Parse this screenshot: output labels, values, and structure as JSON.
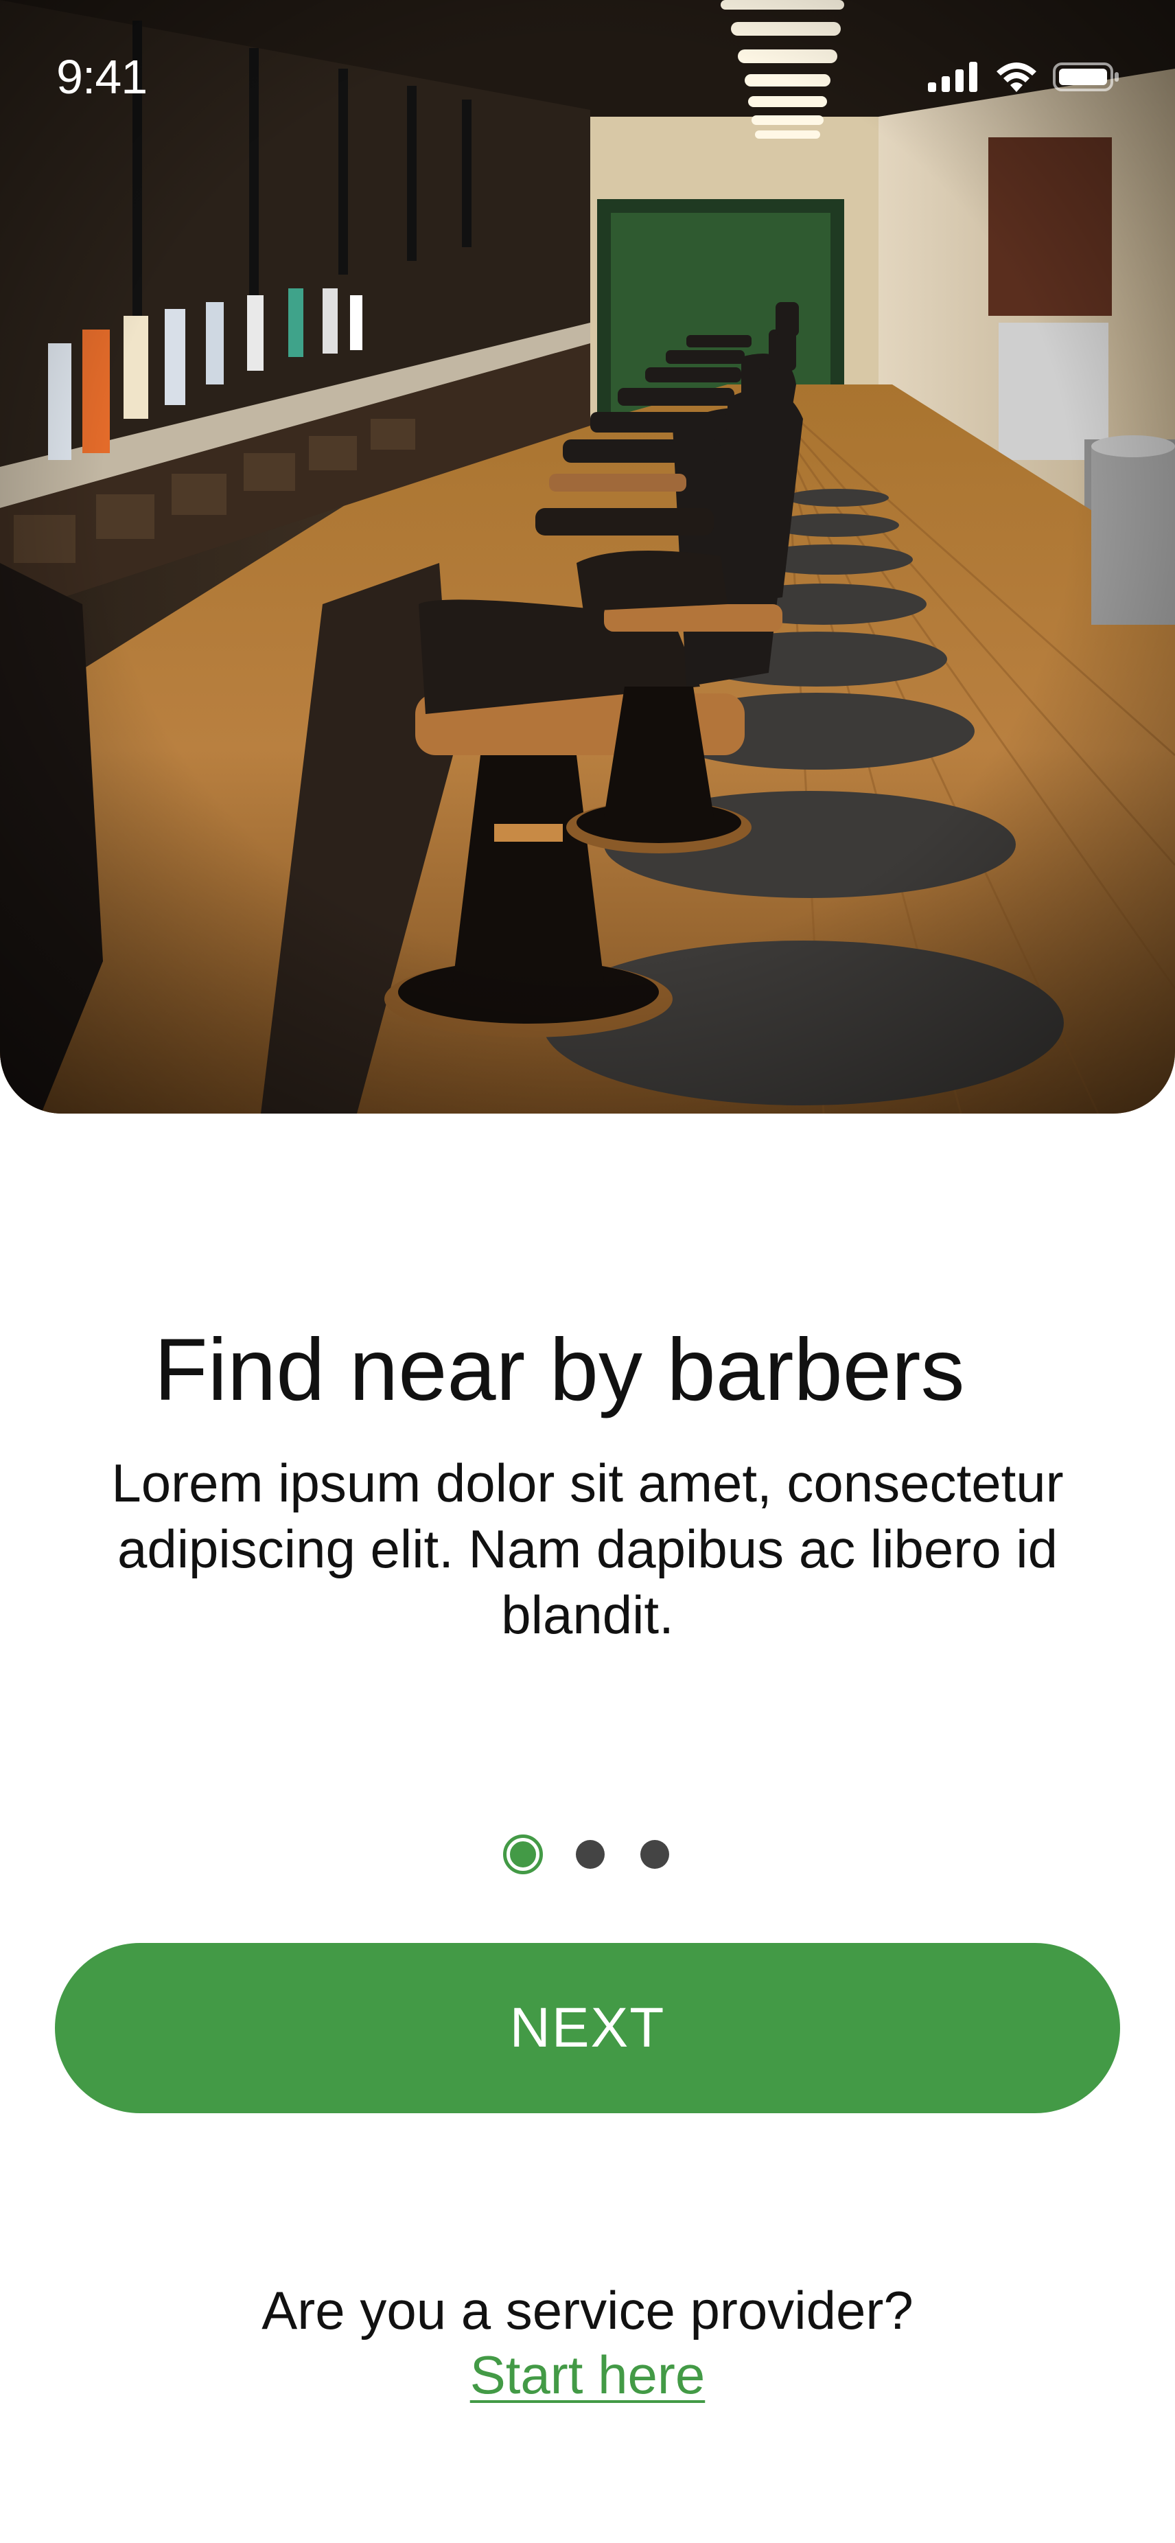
{
  "status_bar": {
    "time": "9:41",
    "icons": [
      "cellular-signal-icon",
      "wifi-icon",
      "battery-icon"
    ]
  },
  "onboarding": {
    "title": "Find near by barbers",
    "description": "Lorem ipsum dolor sit amet, consectetur adipiscing elit. Nam dapibus ac libero id blandit.",
    "page_indicator": {
      "current_page": 1,
      "total_pages": 3
    },
    "next_button_label": "NEXT",
    "provider_question": "Are you a service provider?",
    "provider_link": "Start here"
  },
  "colors": {
    "accent": "#439a46",
    "text": "#111111",
    "inactive_dot": "#444444",
    "background": "#ffffff"
  }
}
